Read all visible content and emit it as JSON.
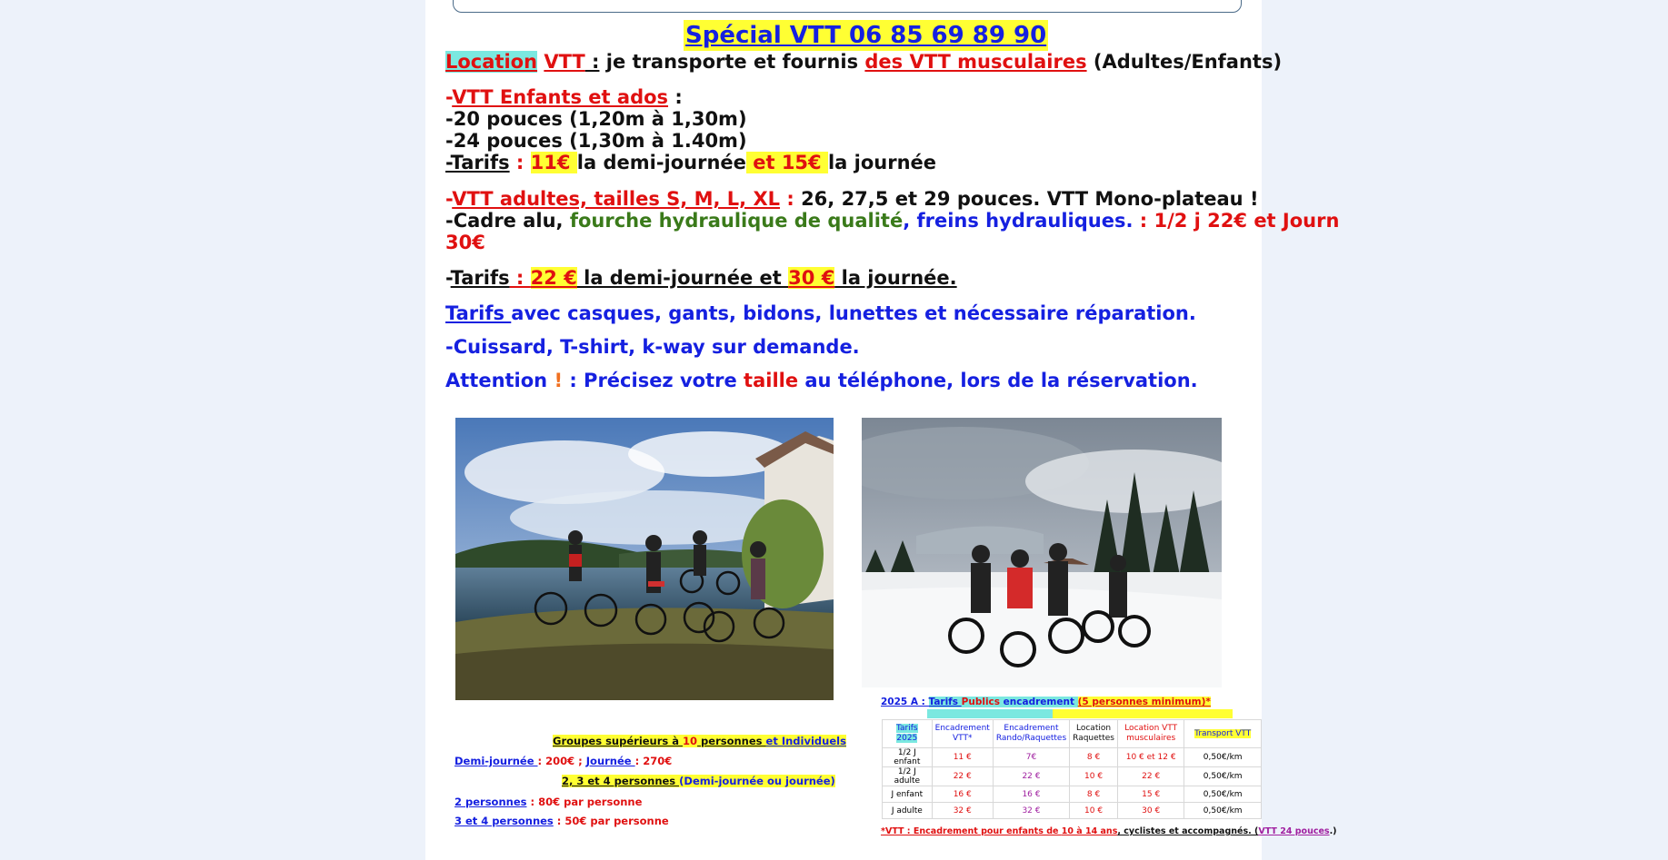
{
  "title": "Spécial VTT 06 85 69 89 90",
  "intro": {
    "location_label": "Location",
    "vtt_label": "VTT",
    "colon": " :",
    "text": " je transporte et fournis ",
    "musculaires": "des VTT musculaires",
    "tail": " (Adultes/Enfants)"
  },
  "kids": {
    "dash": "-",
    "heading": "VTT Enfants et ados",
    "heading_tail": " :",
    "size1": "-20 pouces (1,20m à 1,30m)",
    "size2": "-24 pouces (1,30m à 1.40m)",
    "tarifs_label": "-Tarifs",
    "colon": " : ",
    "price_half": "11€ ",
    "half_text": "la demi-journée",
    "price_full": " et 15€ ",
    "full_text": "la journée"
  },
  "adults": {
    "dash": "-",
    "heading": "VTT  adultes, tailles S, M, L, XL",
    "colon": " : ",
    "sizes": "26,  27,5 et 29 pouces. VTT Mono-plateau !",
    "cadre": "-Cadre alu, ",
    "fourche": "fourche hydraulique de qualité",
    "comma": ", ",
    "freins": "freins hydrauliques.",
    "half_day": " : 1/2 j 22€ et Journ",
    "half_day_2": "30€",
    "tarifs_dash": "-",
    "tarifs_label": "Tarifs",
    "colon2": " : ",
    "price_half": "22 €",
    "mid": " la demi-journée et ",
    "price_full": "30 €",
    "end": " la journée."
  },
  "extras": {
    "tarifs_label": "Tarifs ",
    "tarifs_text": "avec casques, gants, bidons, lunettes et nécessaire réparation.",
    "clothes": "-Cuissard, T-shirt, k-way sur demande.",
    "attention": "Attention ",
    "exclaim": "!",
    "attention_text": " : Précisez votre ",
    "taille": "taille",
    "attention_end": " au téléphone, lors de la réservation."
  },
  "groups": {
    "heading_a": "Groupes supérieurs à ",
    "heading_num": "10",
    "heading_b": " personnes ",
    "heading_c": "et Individuels",
    "demi_label": "Demi-journée ",
    "demi_price": " : 200€ ; ",
    "journee_label": "Journée ",
    "journee_price": " : 270€",
    "small_heading": "2, 3 et 4 personnes ",
    "small_paren": "(Demi-journée ou journée)",
    "two_label": "2 personnes",
    "two_price": " : 80€ par personne",
    "three_label": "3 et 4 personnes",
    "three_price": " : 50€ par personne"
  },
  "pricing_table": {
    "heading_a": "2025 A : ",
    "heading_b": "Tarifs ",
    "heading_c": "Publics",
    "heading_d": " encadrement ",
    "heading_e": "(5 personnes minimum)*",
    "headers": [
      "Tarifs 2025",
      "Encadrement VTT*",
      "Encadrement Rando/Raquettes",
      "Location Raquettes",
      "Location VTT musculaires",
      "Transport  VTT"
    ],
    "rows": [
      [
        "1/2 J enfant",
        "11 €",
        "7€",
        "8 €",
        "10 € et 12 €",
        "0,50€/km"
      ],
      [
        "1/2 J adulte",
        "22 €",
        "22 €",
        "10 €",
        "22 €",
        "0,50€/km"
      ],
      [
        "J enfant",
        "16 €",
        "16 €",
        "8 €",
        "15 €",
        "0,50€/km"
      ],
      [
        "J adulte",
        "32 €",
        "32 €",
        "10 €",
        "30 €",
        "0,50€/km"
      ]
    ],
    "footnote_a": "*VTT : Encadrement pour enfants de ",
    "footnote_b": "10 à 14 ans",
    "footnote_c": ", cyclistes et accompagnés. (",
    "footnote_d": "VTT 24 pouces",
    "footnote_e": ".)"
  },
  "colors": {
    "red": "#e01010",
    "blue": "#1520e0",
    "green": "#3a7a1a",
    "highlight": "#ffff33",
    "cyan": "#7be8e0"
  }
}
